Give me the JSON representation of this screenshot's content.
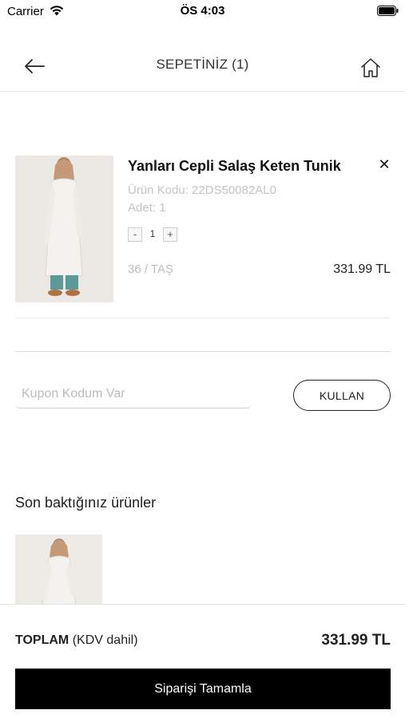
{
  "status_bar": {
    "carrier": "Carrier",
    "time": "ÖS 4:03"
  },
  "header": {
    "title": "SEPETİNİZ (1)"
  },
  "cart": {
    "items": [
      {
        "name": "Yanları Cepli Salaş Keten Tunik",
        "code": "Ürün Kodu: 22DS50082AL0",
        "quantity_label": "Adet: 1",
        "quantity": "1",
        "variant": "36 / TAŞ",
        "price": "331.99 TL"
      }
    ],
    "stepper_minus": "-",
    "stepper_plus": "+",
    "remove_symbol": "✕"
  },
  "coupon": {
    "placeholder": "Kupon Kodum Var",
    "apply_label": "KULLAN"
  },
  "recently_viewed": {
    "title": "Son baktığınız ürünler"
  },
  "total": {
    "label": "TOPLAM",
    "tax_note": "(KDV dahil)",
    "value": "331.99 TL"
  },
  "checkout": {
    "label": "Siparişi Tamamla"
  },
  "icons": {
    "back": "arrow-left-icon",
    "home": "home-icon",
    "remove": "close-icon",
    "wifi": "wifi-icon",
    "battery": "battery-icon"
  },
  "colors": {
    "primary": "#000000",
    "muted_text": "#c4c4c4",
    "divider": "#dcdcdc"
  }
}
